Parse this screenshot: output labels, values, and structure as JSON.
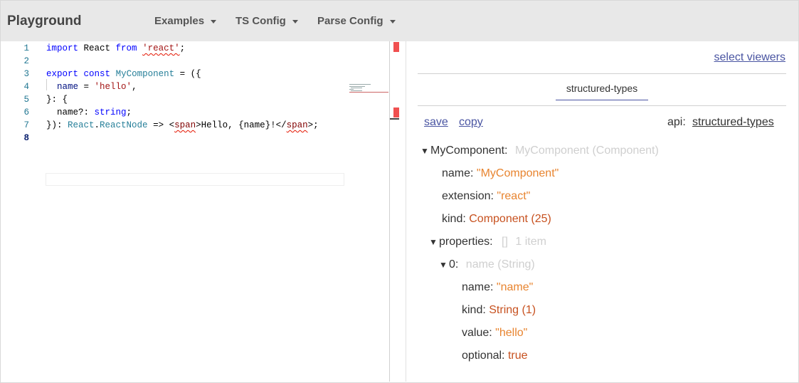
{
  "header": {
    "title": "Playground",
    "menus": [
      {
        "label": "Examples"
      },
      {
        "label": "TS Config"
      },
      {
        "label": "Parse Config"
      }
    ]
  },
  "editor": {
    "line_numbers": [
      "1",
      "2",
      "3",
      "4",
      "5",
      "6",
      "7",
      "8"
    ],
    "lines": [
      {
        "segments": [
          [
            "kw",
            "import"
          ],
          [
            "txt",
            " React "
          ],
          [
            "kw",
            "from"
          ],
          [
            "txt",
            " "
          ],
          [
            "str",
            "'react'"
          ],
          [
            "txt",
            ";"
          ]
        ]
      },
      {
        "segments": []
      },
      {
        "segments": [
          [
            "kw",
            "export"
          ],
          [
            "txt",
            " "
          ],
          [
            "kw",
            "const"
          ],
          [
            "txt",
            " "
          ],
          [
            "ty",
            "MyComponent"
          ],
          [
            "txt",
            " = ({"
          ]
        ]
      },
      {
        "segments": [
          [
            "txt",
            "  "
          ],
          [
            "id",
            "name"
          ],
          [
            "txt",
            " = "
          ],
          [
            "str",
            "'hello'"
          ],
          [
            "txt",
            ","
          ]
        ]
      },
      {
        "segments": [
          [
            "txt",
            "}: {"
          ]
        ]
      },
      {
        "segments": [
          [
            "txt",
            "  name?: "
          ],
          [
            "kw",
            "string"
          ],
          [
            "txt",
            ";"
          ]
        ]
      },
      {
        "segments": [
          [
            "txt",
            "}): "
          ],
          [
            "ty",
            "React"
          ],
          [
            "txt",
            "."
          ],
          [
            "ty",
            "ReactNode"
          ],
          [
            "txt",
            " => <"
          ],
          [
            "tag",
            "span"
          ],
          [
            "txt",
            ">Hello, {name}!</"
          ],
          [
            "tag",
            "span"
          ],
          [
            "txt",
            ">;"
          ]
        ]
      },
      {
        "segments": []
      }
    ]
  },
  "viewer": {
    "select_viewers": "select viewers",
    "tab": "structured-types",
    "save": "save",
    "copy": "copy",
    "api_label": "api:",
    "api_value": "structured-types",
    "tree": {
      "root_key": "MyComponent:",
      "root_hint": "MyComponent (Component)",
      "name_key": "name:",
      "name_val": "\"MyComponent\"",
      "ext_key": "extension:",
      "ext_val": "\"react\"",
      "kind_key": "kind:",
      "kind_val": "Component (25)",
      "props_key": "properties:",
      "props_bracket": "[]",
      "props_hint": "1 item",
      "item_key": "0:",
      "item_hint": "name (String)",
      "p_name_key": "name:",
      "p_name_val": "\"name\"",
      "p_kind_key": "kind:",
      "p_kind_val": "String (1)",
      "p_value_key": "value:",
      "p_value_val": "\"hello\"",
      "p_opt_key": "optional:",
      "p_opt_val": "true"
    }
  },
  "colors": {
    "link": "#4a55a2",
    "string_value": "#e8842f",
    "enum_value": "#c7511f"
  }
}
